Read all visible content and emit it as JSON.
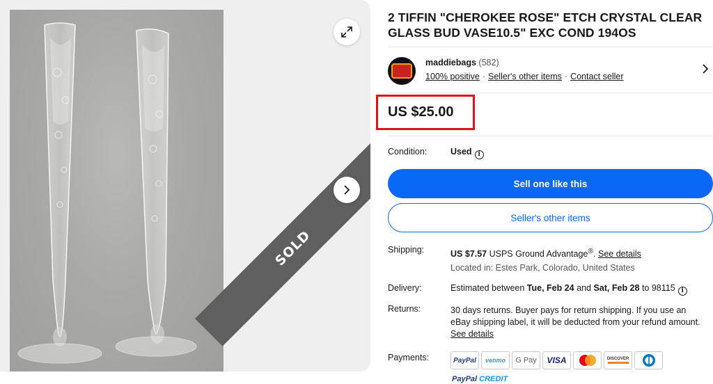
{
  "listing": {
    "title": "2 TIFFIN \"CHEROKEE ROSE\" ETCH CRYSTAL CLEAR GLASS BUD VASE10.5\" EXC COND 194OS",
    "sold_overlay": "SOLD",
    "price": "US $25.00"
  },
  "seller": {
    "name": "maddiebags",
    "feedback_count": "(582)",
    "positive": "100% positive",
    "other_items_link": "Seller's other items",
    "contact_link": "Contact seller"
  },
  "condition": {
    "label": "Condition:",
    "value": "Used"
  },
  "buttons": {
    "sell_one": "Sell one like this",
    "sellers_other_items": "Seller's other items"
  },
  "shipping": {
    "label": "Shipping:",
    "cost": "US $7.57",
    "service": "USPS Ground Advantage",
    "reg": "®",
    "details_link": "See details",
    "location": "Located in: Estes Park, Colorado, United States"
  },
  "delivery": {
    "label": "Delivery:",
    "prefix": "Estimated between",
    "start": "Tue, Feb 24",
    "and": "and",
    "end": "Sat, Feb 28",
    "to": "to 98115"
  },
  "returns": {
    "label": "Returns:",
    "text": "30 days returns. Buyer pays for return shipping. If you use an eBay shipping label, it will be deducted from your refund amount.",
    "details_link": "See details"
  },
  "payments": {
    "label": "Payments:",
    "methods": [
      "PayPal",
      "venmo",
      "G Pay",
      "VISA",
      "Mastercard",
      "DISCOVER",
      "Diners Club"
    ],
    "credit_a": "PayPal",
    "credit_b": "CREDIT"
  },
  "colors": {
    "primary_blue": "#0968f6",
    "highlight_red": "#e0101a",
    "sold_ribbon": "#5f5f5f"
  }
}
